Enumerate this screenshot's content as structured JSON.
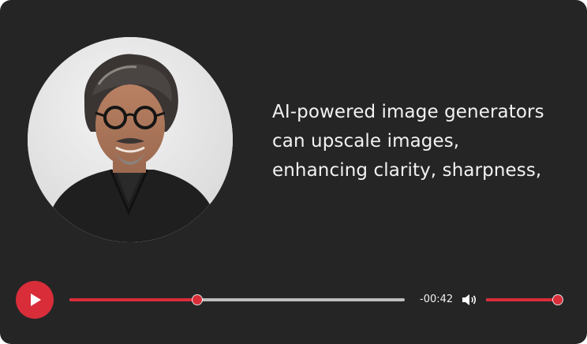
{
  "player": {
    "caption": "AI-powered image generators can upscale images, enhancing clarity, sharpness,",
    "time_remaining": "-00:42",
    "progress": 0.38,
    "volume": 1.0,
    "accent_color": "#d92d3a",
    "background_color": "#252526",
    "track_color": "#bdbdbd",
    "play_icon": "play-icon",
    "volume_icon": "volume-icon"
  }
}
